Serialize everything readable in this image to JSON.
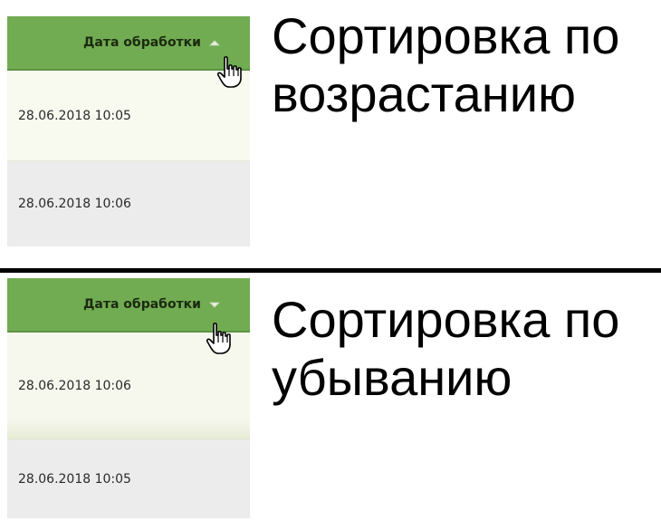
{
  "panels": [
    {
      "header": {
        "label": "Дата обработки",
        "sort_icon": "sort-ascending-icon"
      },
      "rows": [
        "28.06.2018 10:05",
        "28.06.2018 10:06"
      ],
      "caption": "Сортировка по возрастанию"
    },
    {
      "header": {
        "label": "Дата обработки",
        "sort_icon": "sort-descending-icon"
      },
      "rows": [
        "28.06.2018 10:06",
        "28.06.2018 10:05"
      ],
      "caption": "Сортировка по убыванию"
    }
  ],
  "colors": {
    "header_bg": "#72ac52",
    "row_light": "#f8faf0",
    "row_gray": "#ececec"
  }
}
